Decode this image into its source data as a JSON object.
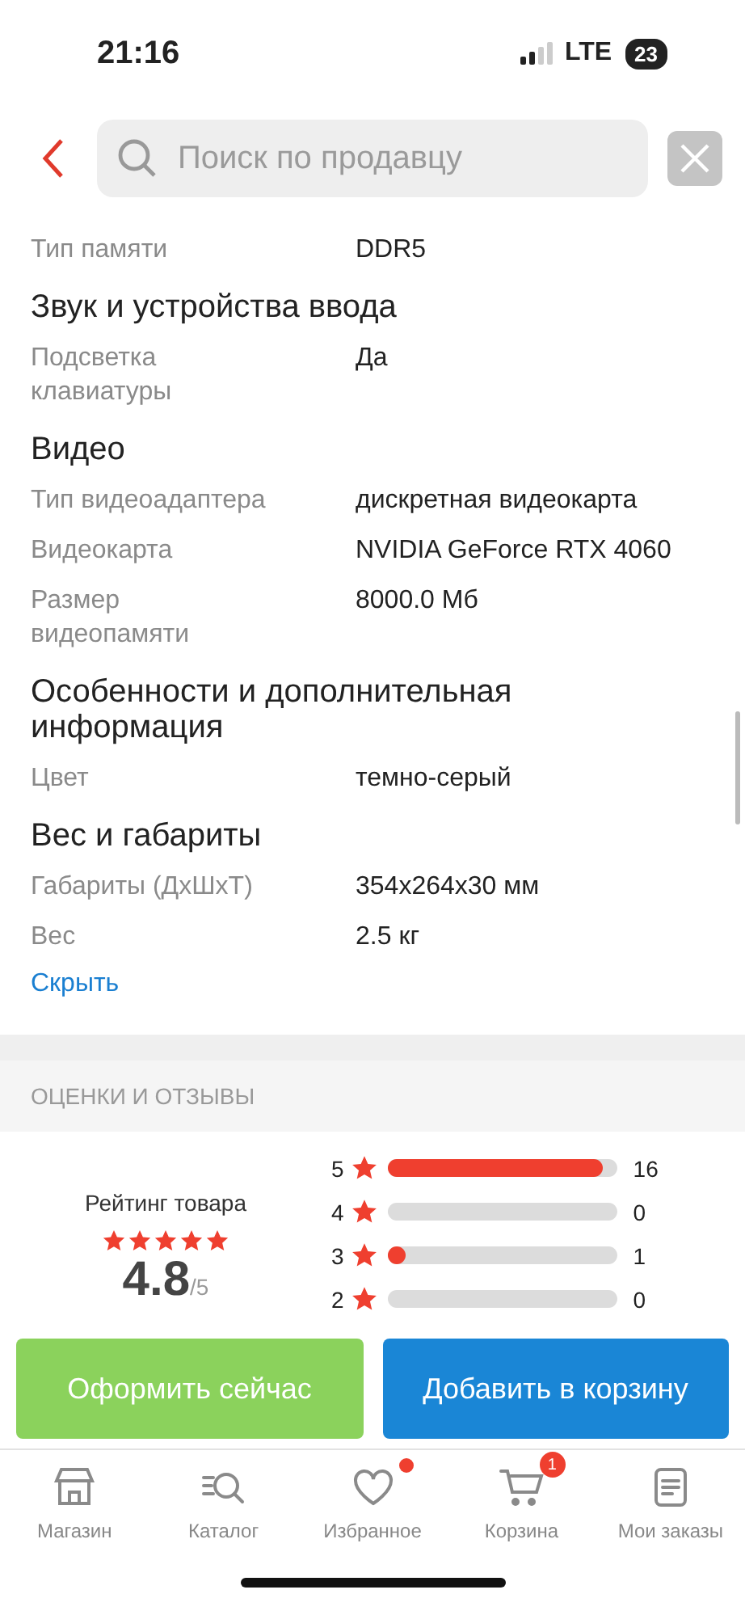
{
  "status_bar": {
    "time": "21:16",
    "network": "LTE",
    "battery": "23"
  },
  "search": {
    "placeholder": "Поиск по продавцу"
  },
  "specs": [
    {
      "rows": [
        {
          "label": "Тип памяти",
          "value": "DDR5"
        }
      ]
    },
    {
      "title": "Звук и устройства ввода",
      "rows": [
        {
          "label": "Подсветка клавиатуры",
          "value": "Да"
        }
      ]
    },
    {
      "title": "Видео",
      "rows": [
        {
          "label": "Тип видеоадаптера",
          "value": "дискретная видеокарта"
        },
        {
          "label": "Видеокарта",
          "value": "NVIDIA GeForce RTX 4060"
        },
        {
          "label": "Размер видеопамяти",
          "value": "8000.0 Мб"
        }
      ]
    },
    {
      "title": "Особенности и дополнительная информация",
      "rows": [
        {
          "label": "Цвет",
          "value": "темно-серый"
        }
      ]
    },
    {
      "title": "Вес и габариты",
      "rows": [
        {
          "label": "Габариты (ДхШхТ)",
          "value": "354x264x30 мм"
        },
        {
          "label": "Вес",
          "value": "2.5 кг"
        }
      ]
    }
  ],
  "hide_link": "Скрыть",
  "reviews": {
    "heading": "ОЦЕНКИ И ОТЗЫВЫ",
    "rating_label": "Рейтинг товара",
    "stars": 5,
    "score": "4.8",
    "score_max": "/5",
    "distribution": [
      {
        "grade": "5",
        "level": 0.94,
        "count": "16"
      },
      {
        "grade": "4",
        "level": 0,
        "count": "0"
      },
      {
        "grade": "3",
        "level": 0.06,
        "count": "1"
      },
      {
        "grade": "2",
        "level": 0,
        "count": "0"
      }
    ]
  },
  "actions": [
    {
      "label": "Оформить сейчас",
      "kind": "secondary"
    },
    {
      "label": "Добавить в корзину",
      "kind": "primary"
    }
  ],
  "tab_bar": [
    {
      "label": "Магазин",
      "badge": false
    },
    {
      "label": "Каталог",
      "badge": false
    },
    {
      "label": "Избранное",
      "badge": true
    },
    {
      "label": "Корзина",
      "badge": "1"
    },
    {
      "label": "Мои заказы",
      "badge": false
    }
  ]
}
